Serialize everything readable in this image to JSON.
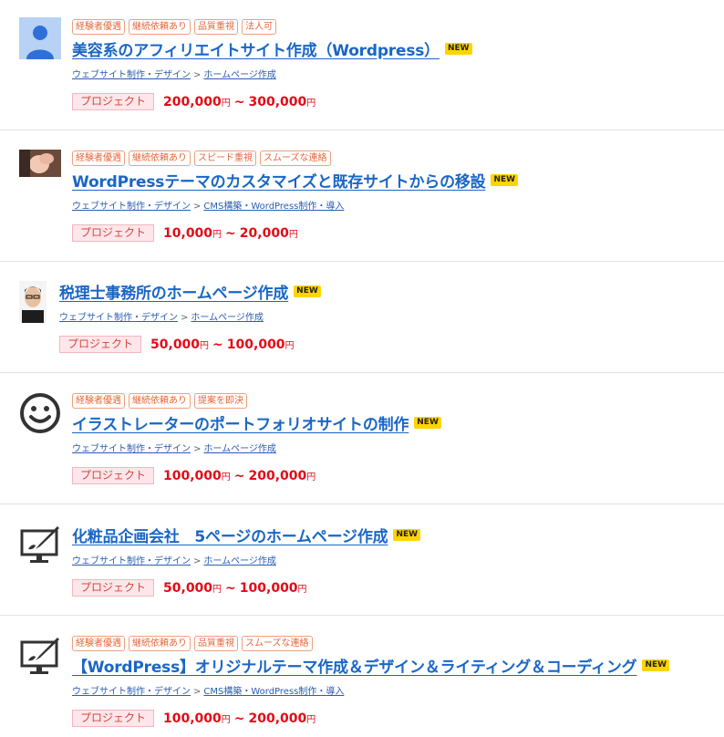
{
  "jobs": [
    {
      "tags": [
        "経験者優遇",
        "継続依頼あり",
        "品質重視",
        "法人可"
      ],
      "title": "美容系のアフィリエイトサイト作成（Wordpress）",
      "new_label": "NEW",
      "category": "ウェブサイト制作・デザイン",
      "subcategory": "ホームページ作成",
      "kind": "プロジェクト",
      "price_min": "200,000",
      "price_max": "300,000",
      "currency": "円",
      "range_sep": "~"
    },
    {
      "tags": [
        "経験者優遇",
        "継続依頼あり",
        "スピード重視",
        "スムーズな連絡"
      ],
      "title": "WordPressテーマのカスタマイズと既存サイトからの移設",
      "new_label": "NEW",
      "category": "ウェブサイト制作・デザイン",
      "subcategory": "CMS構築・WordPress制作・導入",
      "kind": "プロジェクト",
      "price_min": "10,000",
      "price_max": "20,000",
      "currency": "円",
      "range_sep": "~"
    },
    {
      "tags": [],
      "title": "税理士事務所のホームページ作成",
      "new_label": "NEW",
      "category": "ウェブサイト制作・デザイン",
      "subcategory": "ホームページ作成",
      "kind": "プロジェクト",
      "price_min": "50,000",
      "price_max": "100,000",
      "currency": "円",
      "range_sep": "~"
    },
    {
      "tags": [
        "経験者優遇",
        "継続依頼あり",
        "提案を即決"
      ],
      "title": "イラストレーターのポートフォリオサイトの制作",
      "new_label": "NEW",
      "category": "ウェブサイト制作・デザイン",
      "subcategory": "ホームページ作成",
      "kind": "プロジェクト",
      "price_min": "100,000",
      "price_max": "200,000",
      "currency": "円",
      "range_sep": "~"
    },
    {
      "tags": [],
      "title": "化粧品企画会社　5ページのホームページ作成",
      "new_label": "NEW",
      "category": "ウェブサイト制作・デザイン",
      "subcategory": "ホームページ作成",
      "kind": "プロジェクト",
      "price_min": "50,000",
      "price_max": "100,000",
      "currency": "円",
      "range_sep": "~"
    },
    {
      "tags": [
        "経験者優遇",
        "継続依頼あり",
        "品質重視",
        "スムーズな連絡"
      ],
      "title": "【WordPress】オリジナルテーマ作成＆デザイン＆ライティング＆コーディング",
      "new_label": "NEW",
      "category": "ウェブサイト制作・デザイン",
      "subcategory": "CMS構築・WordPress制作・導入",
      "kind": "プロジェクト",
      "price_min": "100,000",
      "price_max": "200,000",
      "currency": "円",
      "range_sep": "~"
    }
  ],
  "colors": {
    "link": "#1a66c6",
    "price": "#e30a17",
    "tag": "#e8663b",
    "new_badge": "#ffd400"
  }
}
